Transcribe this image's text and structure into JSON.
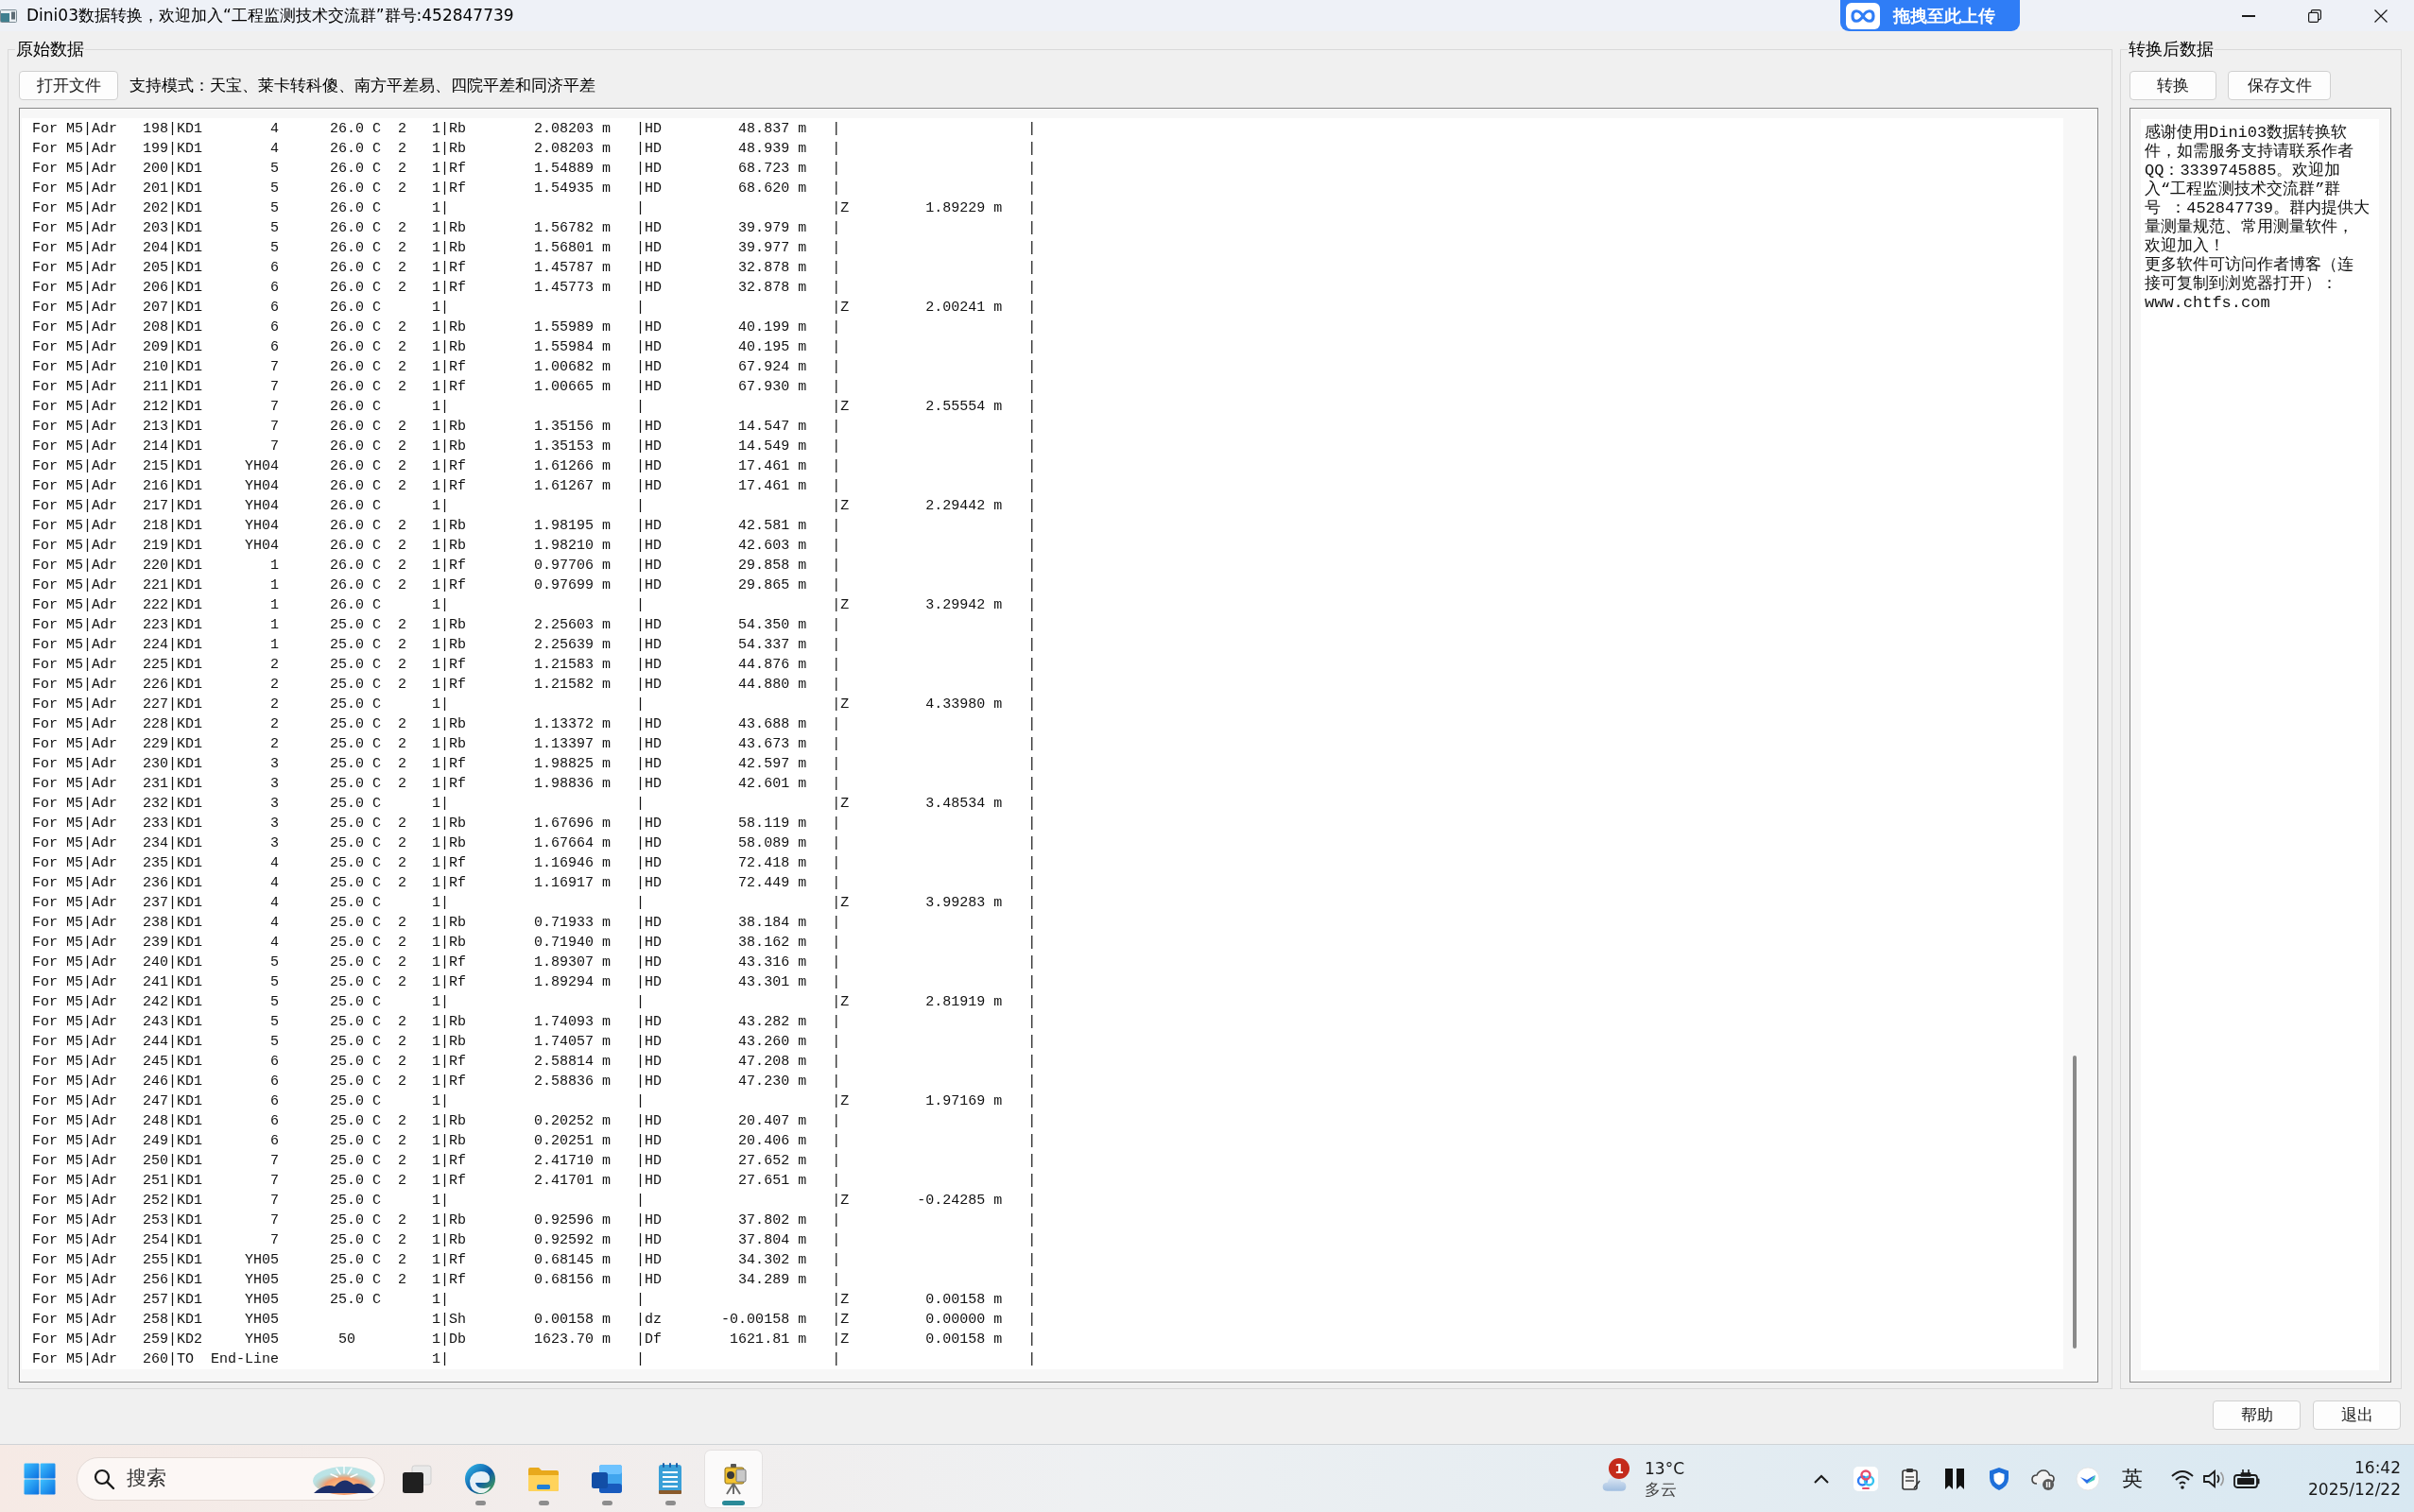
{
  "window": {
    "title": "Dini03数据转换，欢迎加入“工程监测技术交流群”群号:452847739"
  },
  "upload_widget": {
    "label": "拖拽至此上传"
  },
  "source_panel": {
    "title": "原始数据",
    "open_button": "打开文件",
    "modes_note": "支持模式：天宝、莱卡转科傻、南方平差易、四院平差和同济平差",
    "lines": [
      "For M5|Adr   198|KD1        4      26.0 C  2   1|Rb        2.08203 m   |HD         48.837 m   |                      |",
      "For M5|Adr   199|KD1        4      26.0 C  2   1|Rb        2.08203 m   |HD         48.939 m   |                      |",
      "For M5|Adr   200|KD1        5      26.0 C  2   1|Rf        1.54889 m   |HD         68.723 m   |                      |",
      "For M5|Adr   201|KD1        5      26.0 C  2   1|Rf        1.54935 m   |HD         68.620 m   |                      |",
      "For M5|Adr   202|KD1        5      26.0 C      1|                      |                      |Z         1.89229 m   |",
      "For M5|Adr   203|KD1        5      26.0 C  2   1|Rb        1.56782 m   |HD         39.979 m   |                      |",
      "For M5|Adr   204|KD1        5      26.0 C  2   1|Rb        1.56801 m   |HD         39.977 m   |                      |",
      "For M5|Adr   205|KD1        6      26.0 C  2   1|Rf        1.45787 m   |HD         32.878 m   |                      |",
      "For M5|Adr   206|KD1        6      26.0 C  2   1|Rf        1.45773 m   |HD         32.878 m   |                      |",
      "For M5|Adr   207|KD1        6      26.0 C      1|                      |                      |Z         2.00241 m   |",
      "For M5|Adr   208|KD1        6      26.0 C  2   1|Rb        1.55989 m   |HD         40.199 m   |                      |",
      "For M5|Adr   209|KD1        6      26.0 C  2   1|Rb        1.55984 m   |HD         40.195 m   |                      |",
      "For M5|Adr   210|KD1        7      26.0 C  2   1|Rf        1.00682 m   |HD         67.924 m   |                      |",
      "For M5|Adr   211|KD1        7      26.0 C  2   1|Rf        1.00665 m   |HD         67.930 m   |                      |",
      "For M5|Adr   212|KD1        7      26.0 C      1|                      |                      |Z         2.55554 m   |",
      "For M5|Adr   213|KD1        7      26.0 C  2   1|Rb        1.35156 m   |HD         14.547 m   |                      |",
      "For M5|Adr   214|KD1        7      26.0 C  2   1|Rb        1.35153 m   |HD         14.549 m   |                      |",
      "For M5|Adr   215|KD1     YH04      26.0 C  2   1|Rf        1.61266 m   |HD         17.461 m   |                      |",
      "For M5|Adr   216|KD1     YH04      26.0 C  2   1|Rf        1.61267 m   |HD         17.461 m   |                      |",
      "For M5|Adr   217|KD1     YH04      26.0 C      1|                      |                      |Z         2.29442 m   |",
      "For M5|Adr   218|KD1     YH04      26.0 C  2   1|Rb        1.98195 m   |HD         42.581 m   |                      |",
      "For M5|Adr   219|KD1     YH04      26.0 C  2   1|Rb        1.98210 m   |HD         42.603 m   |                      |",
      "For M5|Adr   220|KD1        1      26.0 C  2   1|Rf        0.97706 m   |HD         29.858 m   |                      |",
      "For M5|Adr   221|KD1        1      26.0 C  2   1|Rf        0.97699 m   |HD         29.865 m   |                      |",
      "For M5|Adr   222|KD1        1      26.0 C      1|                      |                      |Z         3.29942 m   |",
      "For M5|Adr   223|KD1        1      25.0 C  2   1|Rb        2.25603 m   |HD         54.350 m   |                      |",
      "For M5|Adr   224|KD1        1      25.0 C  2   1|Rb        2.25639 m   |HD         54.337 m   |                      |",
      "For M5|Adr   225|KD1        2      25.0 C  2   1|Rf        1.21583 m   |HD         44.876 m   |                      |",
      "For M5|Adr   226|KD1        2      25.0 C  2   1|Rf        1.21582 m   |HD         44.880 m   |                      |",
      "For M5|Adr   227|KD1        2      25.0 C      1|                      |                      |Z         4.33980 m   |",
      "For M5|Adr   228|KD1        2      25.0 C  2   1|Rb        1.13372 m   |HD         43.688 m   |                      |",
      "For M5|Adr   229|KD1        2      25.0 C  2   1|Rb        1.13397 m   |HD         43.673 m   |                      |",
      "For M5|Adr   230|KD1        3      25.0 C  2   1|Rf        1.98825 m   |HD         42.597 m   |                      |",
      "For M5|Adr   231|KD1        3      25.0 C  2   1|Rf        1.98836 m   |HD         42.601 m   |                      |",
      "For M5|Adr   232|KD1        3      25.0 C      1|                      |                      |Z         3.48534 m   |",
      "For M5|Adr   233|KD1        3      25.0 C  2   1|Rb        1.67696 m   |HD         58.119 m   |                      |",
      "For M5|Adr   234|KD1        3      25.0 C  2   1|Rb        1.67664 m   |HD         58.089 m   |                      |",
      "For M5|Adr   235|KD1        4      25.0 C  2   1|Rf        1.16946 m   |HD         72.418 m   |                      |",
      "For M5|Adr   236|KD1        4      25.0 C  2   1|Rf        1.16917 m   |HD         72.449 m   |                      |",
      "For M5|Adr   237|KD1        4      25.0 C      1|                      |                      |Z         3.99283 m   |",
      "For M5|Adr   238|KD1        4      25.0 C  2   1|Rb        0.71933 m   |HD         38.184 m   |                      |",
      "For M5|Adr   239|KD1        4      25.0 C  2   1|Rb        0.71940 m   |HD         38.162 m   |                      |",
      "For M5|Adr   240|KD1        5      25.0 C  2   1|Rf        1.89307 m   |HD         43.316 m   |                      |",
      "For M5|Adr   241|KD1        5      25.0 C  2   1|Rf        1.89294 m   |HD         43.301 m   |                      |",
      "For M5|Adr   242|KD1        5      25.0 C      1|                      |                      |Z         2.81919 m   |",
      "For M5|Adr   243|KD1        5      25.0 C  2   1|Rb        1.74093 m   |HD         43.282 m   |                      |",
      "For M5|Adr   244|KD1        5      25.0 C  2   1|Rb        1.74057 m   |HD         43.260 m   |                      |",
      "For M5|Adr   245|KD1        6      25.0 C  2   1|Rf        2.58814 m   |HD         47.208 m   |                      |",
      "For M5|Adr   246|KD1        6      25.0 C  2   1|Rf        2.58836 m   |HD         47.230 m   |                      |",
      "For M5|Adr   247|KD1        6      25.0 C      1|                      |                      |Z         1.97169 m   |",
      "For M5|Adr   248|KD1        6      25.0 C  2   1|Rb        0.20252 m   |HD         20.407 m   |                      |",
      "For M5|Adr   249|KD1        6      25.0 C  2   1|Rb        0.20251 m   |HD         20.406 m   |                      |",
      "For M5|Adr   250|KD1        7      25.0 C  2   1|Rf        2.41710 m   |HD         27.652 m   |                      |",
      "For M5|Adr   251|KD1        7      25.0 C  2   1|Rf        2.41701 m   |HD         27.651 m   |                      |",
      "For M5|Adr   252|KD1        7      25.0 C      1|                      |                      |Z        -0.24285 m   |",
      "For M5|Adr   253|KD1        7      25.0 C  2   1|Rb        0.92596 m   |HD         37.802 m   |                      |",
      "For M5|Adr   254|KD1        7      25.0 C  2   1|Rb        0.92592 m   |HD         37.804 m   |                      |",
      "For M5|Adr   255|KD1     YH05      25.0 C  2   1|Rf        0.68145 m   |HD         34.302 m   |                      |",
      "For M5|Adr   256|KD1     YH05      25.0 C  2   1|Rf        0.68156 m   |HD         34.289 m   |                      |",
      "For M5|Adr   257|KD1     YH05      25.0 C      1|                      |                      |Z         0.00158 m   |",
      "For M5|Adr   258|KD1     YH05                  1|Sh        0.00158 m   |dz       -0.00158 m   |Z         0.00000 m   |",
      "For M5|Adr   259|KD2     YH05       50         1|Db        1623.70 m   |Df        1621.81 m   |Z         0.00158 m   |",
      "For M5|Adr   260|TO  End-Line                  1|                      |                      |                      |"
    ]
  },
  "result_panel": {
    "title": "转换后数据",
    "buttons": [
      "转换",
      "保存文件"
    ],
    "message_lines": [
      "感谢使用Dini03数据转换软",
      "件，如需服务支持请联系作者",
      "QQ：3339745885。欢迎加",
      "入“工程监测技术交流群”群",
      "号 ：452847739。群内提供大",
      "量测量规范、常用测量软件，",
      "欢迎加入！",
      "更多软件可访问作者博客（连",
      "接可复制到浏览器打开）：",
      "www.chtfs.com"
    ]
  },
  "footer_buttons": [
    "帮助",
    "退出"
  ],
  "taskbar": {
    "search": {
      "placeholder": "搜索"
    },
    "apps": [
      {
        "kind": "task-view",
        "running": false,
        "selected": false
      },
      {
        "kind": "browser",
        "running": true,
        "selected": false
      },
      {
        "kind": "folder",
        "running": true,
        "selected": false
      },
      {
        "kind": "document",
        "running": true,
        "selected": false
      },
      {
        "kind": "notepad",
        "running": true,
        "selected": false
      },
      {
        "kind": "app",
        "running": true,
        "selected": true
      }
    ],
    "weather": {
      "badge": "1",
      "temperature": "13°C",
      "condition": "多云"
    },
    "input_mode": "英",
    "clock": {
      "time": "16:42",
      "date": "2025/12/22"
    }
  }
}
